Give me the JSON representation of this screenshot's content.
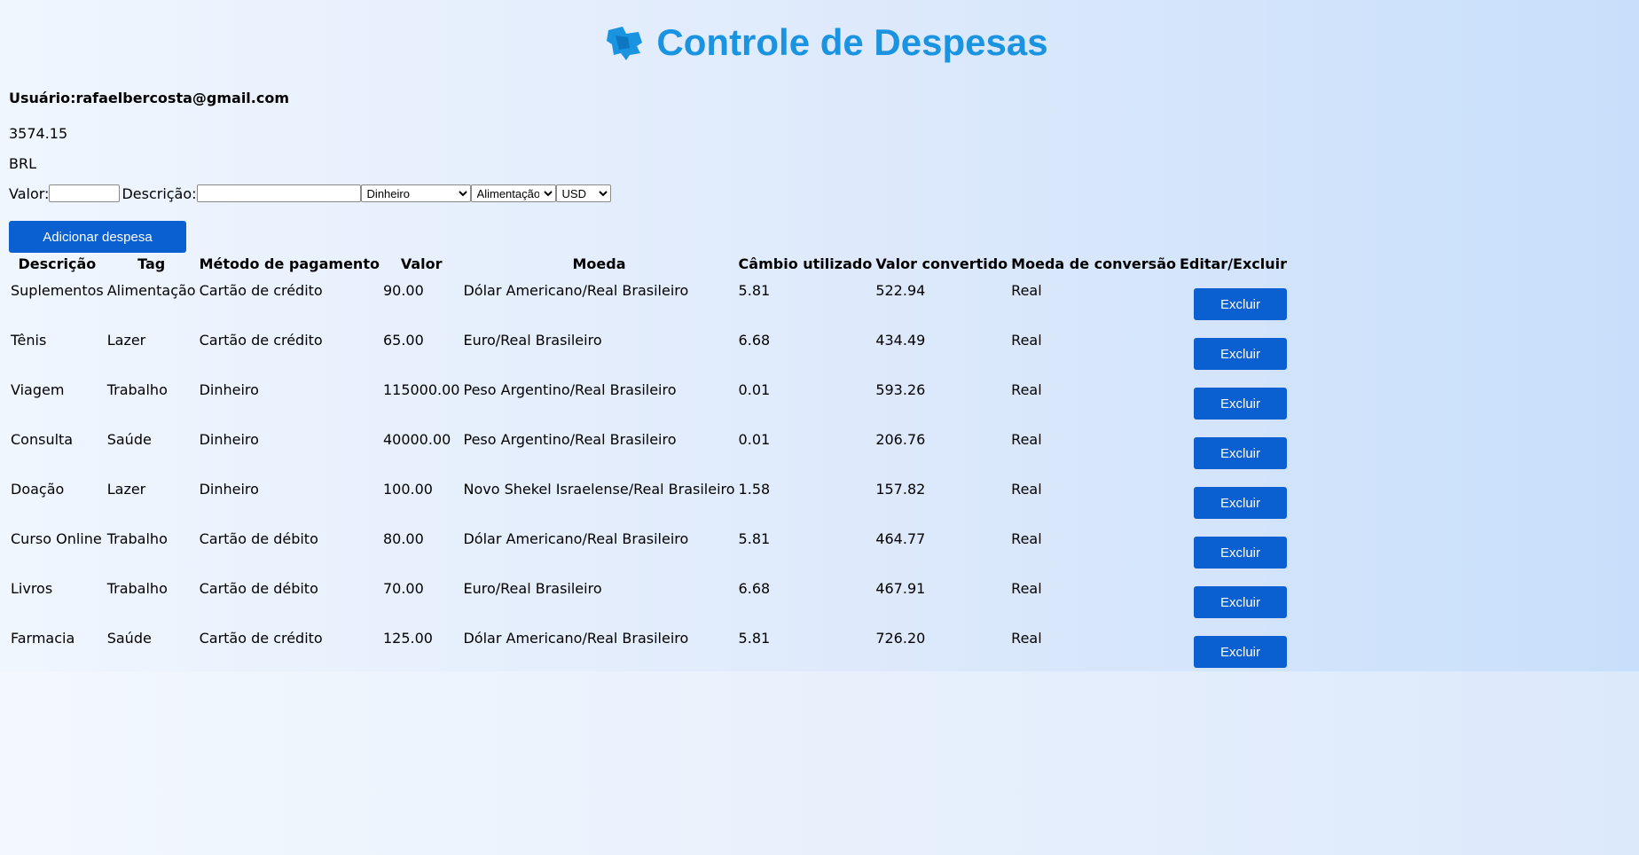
{
  "header": {
    "title": "Controle de Despesas",
    "logo_icon": "wallet-icon",
    "title_color": "#1a93e0"
  },
  "user": {
    "label": "Usuário:rafaelbercosta@gmail.com"
  },
  "summary": {
    "total": "3574.15",
    "currency": "BRL"
  },
  "form": {
    "valor_label": "Valor:",
    "valor_value": "",
    "descricao_label": "Descrição:",
    "descricao_value": "",
    "method_selected": "Dinheiro",
    "tag_selected": "Alimentação",
    "currency_selected": "USD",
    "add_button": "Adicionar despesa",
    "button_color": "#0a5fd1"
  },
  "table": {
    "headers": [
      "Descrição",
      "Tag",
      "Método de pagamento",
      "Valor",
      "Moeda",
      "Câmbio utilizado",
      "Valor convertido",
      "Moeda de conversão",
      "Editar/Excluir"
    ],
    "delete_label": "Excluir",
    "rows": [
      [
        "Suplementos",
        "Alimentação",
        "Cartão de crédito",
        "90.00",
        "Dólar Americano/Real Brasileiro",
        "5.81",
        "522.94",
        "Real"
      ],
      [
        "Tênis",
        "Lazer",
        "Cartão de crédito",
        "65.00",
        "Euro/Real Brasileiro",
        "6.68",
        "434.49",
        "Real"
      ],
      [
        "Viagem",
        "Trabalho",
        "Dinheiro",
        "115000.00",
        "Peso Argentino/Real Brasileiro",
        "0.01",
        "593.26",
        "Real"
      ],
      [
        "Consulta",
        "Saúde",
        "Dinheiro",
        "40000.00",
        "Peso Argentino/Real Brasileiro",
        "0.01",
        "206.76",
        "Real"
      ],
      [
        "Doação",
        "Lazer",
        "Dinheiro",
        "100.00",
        "Novo Shekel Israelense/Real Brasileiro",
        "1.58",
        "157.82",
        "Real"
      ],
      [
        "Curso Online",
        "Trabalho",
        "Cartão de débito",
        "80.00",
        "Dólar Americano/Real Brasileiro",
        "5.81",
        "464.77",
        "Real"
      ],
      [
        "Livros",
        "Trabalho",
        "Cartão de débito",
        "70.00",
        "Euro/Real Brasileiro",
        "6.68",
        "467.91",
        "Real"
      ],
      [
        "Farmacia",
        "Saúde",
        "Cartão de crédito",
        "125.00",
        "Dólar Americano/Real Brasileiro",
        "5.81",
        "726.20",
        "Real"
      ]
    ]
  }
}
